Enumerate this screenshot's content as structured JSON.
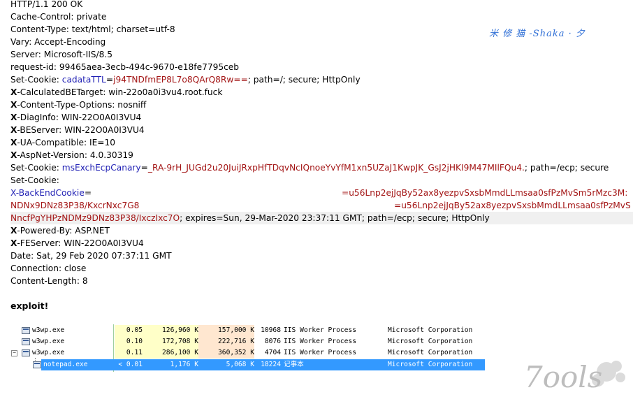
{
  "headers": [
    {
      "text": "HTTP/1.1 200 OK"
    },
    {
      "text": "Cache-Control: private"
    },
    {
      "text": "Content-Type: text/html; charset=utf-8"
    },
    {
      "text": "Vary: Accept-Encoding"
    },
    {
      "text": "Server: Microsoft-IIS/8.5"
    },
    {
      "text": "request-id: 99465aea-3ecb-494c-9670-e18fe7795ceb"
    }
  ],
  "cookie1": {
    "name": "Set-Cookie: ",
    "ckey": "cadataTTL",
    "eq": "=",
    "cval": "j94TNDfmEP8L7o8QArQ8Rw==",
    "rest": "; path=/; secure; HttpOnly"
  },
  "headers2": [
    {
      "first": "X",
      "text": "-CalculatedBETarget: win-22o0a0i3vu4.root.fuck"
    },
    {
      "first": "X",
      "text": "-Content-Type-Options: nosniff"
    },
    {
      "first": "X",
      "text": "-DiagInfo: WIN-22O0A0I3VU4"
    },
    {
      "first": "X",
      "text": "-BEServer: WIN-22O0A0I3VU4"
    },
    {
      "first": "X",
      "text": "-UA-Compatible: IE=10"
    },
    {
      "first": "X",
      "text": "-AspNet-Version: 4.0.30319"
    }
  ],
  "cookie2": {
    "name": "Set-Cookie: ",
    "ckey": "msExchEcpCanary",
    "eq": "=",
    "cval": "_RA-9rH_JUGd2u20JuiJRxpHfTDqvNcIQnoeYvYfM1xn5UZaJ1KwpJK_GsJ2jHKI9M47MIlFQu4.",
    "rest": "; path=/ecp; secure"
  },
  "cookie3_label": "Set-Cookie:",
  "backend": {
    "key": "X-BackEndCookie",
    "eq": "=",
    "val1": "=u56Lnp2ejJqBy52ax8yezpvSxsbMmdLLmsaa0sfPzMvSm5rMzc3M:",
    "line2a": "NDNx9DNz83P38/KxcrNxc7G8",
    "val2": "=u56Lnp2ejJqBy52ax8yezpvSxsbMmdLLmsaa0sfPzMvS",
    "line3": "NncfPgYHPzNDMz9DNz83P38/IxczIxc7O",
    "rest3": "; expires=Sun, 29-Mar-2020 23:37:11 GMT; path=/ecp; secure; HttpOnly"
  },
  "headers3": [
    {
      "first": "X",
      "text": "-Powered-By: ASP.NET"
    },
    {
      "first": "X",
      "text": "-FEServer: WIN-22O0A0I3VU4"
    }
  ],
  "headers4": [
    {
      "text": "Date: Sat, 29 Feb 2020 07:37:11 GMT"
    },
    {
      "text": "Connection: close"
    },
    {
      "text": "Content-Length: 8"
    }
  ],
  "watermark": "米 修 猫 -Shaka · 夕",
  "exploit_label": "exploit!",
  "processes": [
    {
      "name": "w3wp.exe",
      "cpu": "0.05",
      "priv": "126,960 K",
      "ws": "157,000 K",
      "pid": "10968",
      "desc": "IIS Worker Process",
      "company": "Microsoft Corporation"
    },
    {
      "name": "w3wp.exe",
      "cpu": "0.10",
      "priv": "172,708 K",
      "ws": "222,716 K",
      "pid": "8076",
      "desc": "IIS Worker Process",
      "company": "Microsoft Corporation"
    },
    {
      "name": "w3wp.exe",
      "cpu": "0.11",
      "priv": "286,100 K",
      "ws": "360,352 K",
      "pid": "4704",
      "desc": "IIS Worker Process",
      "company": "Microsoft Corporation"
    },
    {
      "name": "notepad.exe",
      "cpu": "< 0.01",
      "priv": "1,176 K",
      "ws": "5,068 K",
      "pid": "18224",
      "desc": "记事本",
      "company": "Microsoft Corporation",
      "selected": true
    }
  ],
  "expander_symbol": "−",
  "logo_text": "7ools",
  "colors": {
    "cookie_key": "#1f1fb4",
    "cookie_value": "#a31515",
    "selection": "#3399ff",
    "watermark": "#2f6fd6"
  }
}
